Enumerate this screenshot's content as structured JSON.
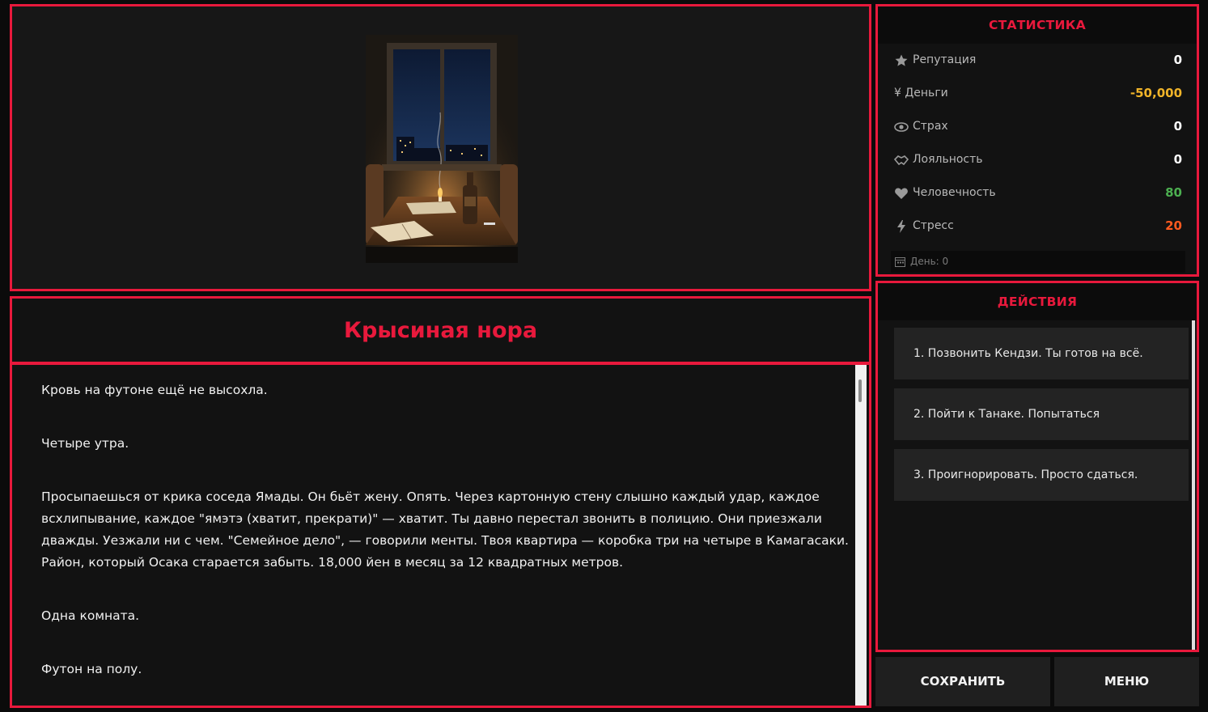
{
  "scene": {
    "image_name": "night-room-window-candle-illustration",
    "colors": {
      "accent": "#e8193c",
      "money": "#f0b429",
      "humanity": "#4caf50",
      "stress": "#ff5a1f"
    }
  },
  "location": {
    "title": "Крысиная нора"
  },
  "story": {
    "paragraphs": [
      "Кровь на футоне ещё не высохла.",
      "Четыре утра.",
      "Просыпаешься от крика соседа Ямады. Он бьёт жену. Опять. Через картонную стену слышно каждый удар, каждое всхлипывание, каждое \"ямэтэ (хватит, прекрати)\" — хватит. Ты давно перестал звонить в полицию. Они приезжали дважды. Уезжали ни с чем. \"Семейное дело\", — говорили менты. Твоя квартира — коробка три на четыре в Камагасаки. Район, который Осака старается забыть. 18,000 йен в месяц за 12 квадратных метров.",
      "Одна комната.",
      "Футон на полу."
    ]
  },
  "stats": {
    "header": "СТАТИСТИКА",
    "items": [
      {
        "icon": "star-icon",
        "label": "Репутация",
        "value": "0",
        "color": "#ffffff"
      },
      {
        "icon": "",
        "label": "¥ Деньги",
        "value": "-50,000",
        "color": "#f0b429"
      },
      {
        "icon": "eye-icon",
        "label": "Страх",
        "value": "0",
        "color": "#ffffff"
      },
      {
        "icon": "handshake-icon",
        "label": "Лояльность",
        "value": "0",
        "color": "#ffffff"
      },
      {
        "icon": "heart-icon",
        "label": "Человечность",
        "value": "80",
        "color": "#4caf50"
      },
      {
        "icon": "lightning-icon",
        "label": "Стресс",
        "value": "20",
        "color": "#ff5a1f"
      }
    ],
    "day": "День: 0"
  },
  "actions": {
    "header": "ДЕЙСТВИЯ",
    "items": [
      "1. Позвонить Кендзи. Ты готов на всё.",
      "2. Пойти к Танаке. Попытаться договориться.",
      "3. Проигнорировать. Просто сдаться."
    ]
  },
  "buttons": {
    "save": "СОХРАНИТЬ",
    "menu": "МЕНЮ"
  }
}
